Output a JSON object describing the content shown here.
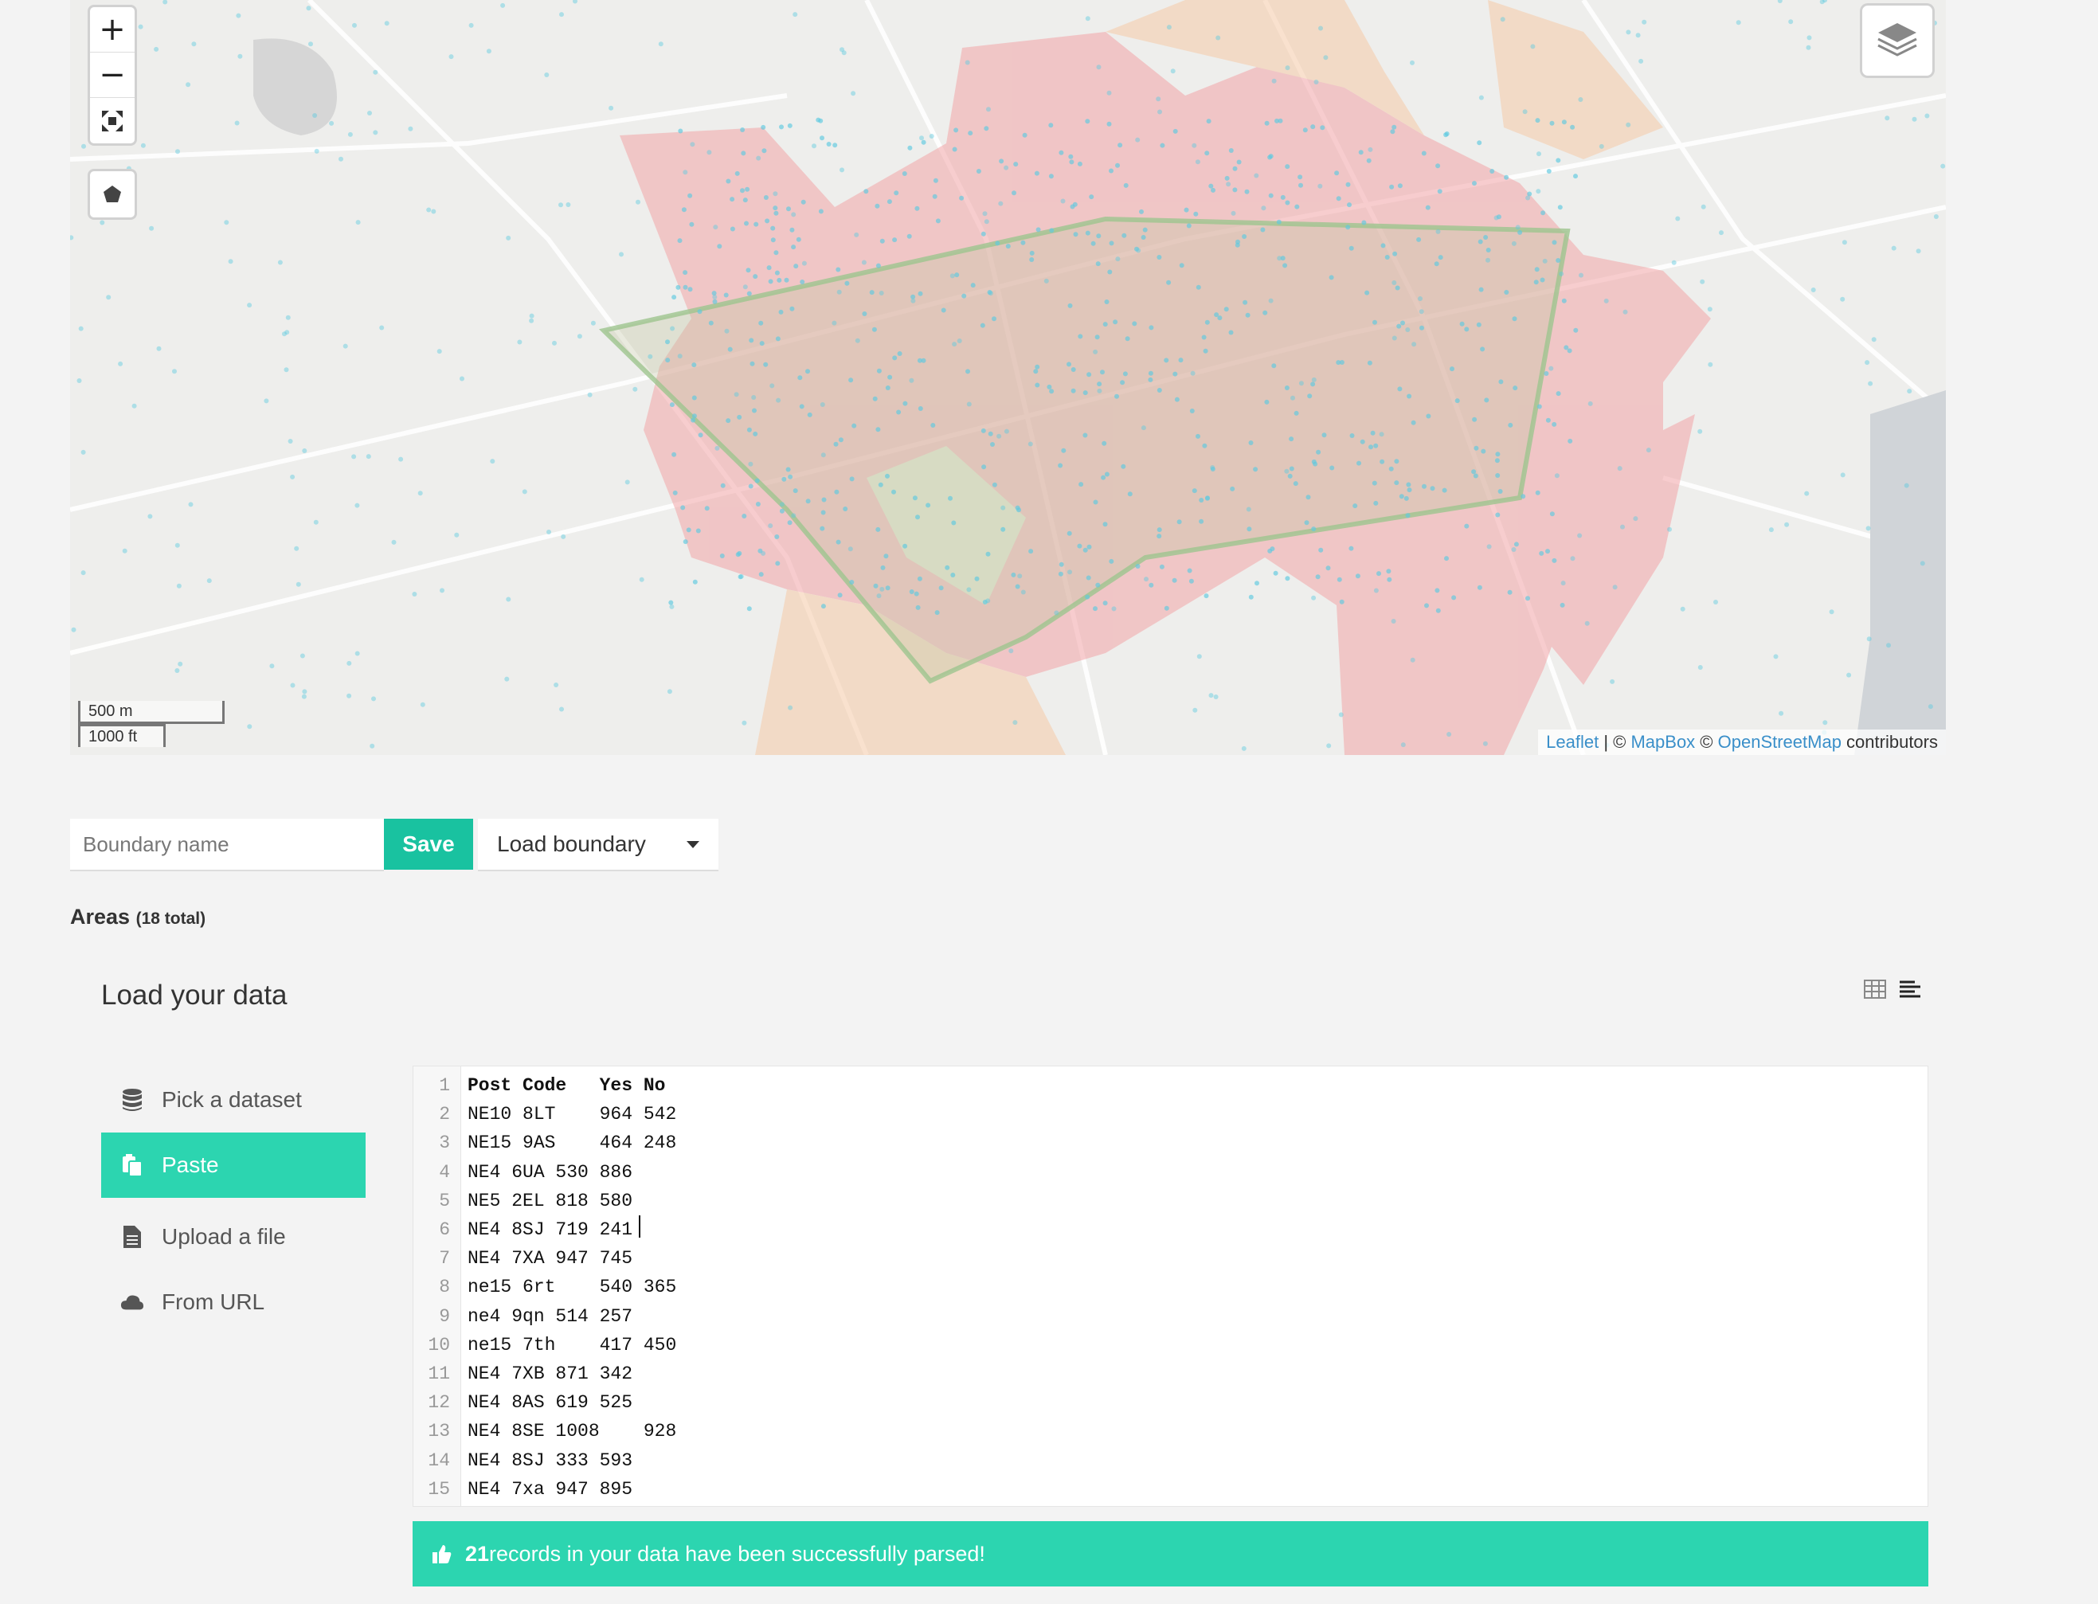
{
  "map": {
    "zoom_in": "+",
    "zoom_out": "−",
    "scale_metric": "500 m",
    "scale_imperial": "1000 ft",
    "attribution": {
      "leaflet": "Leaflet",
      "sep1": " | © ",
      "mapbox": "MapBox",
      "sep2": " © ",
      "osm": "OpenStreetMap",
      "tail": " contributors"
    },
    "colors": {
      "area_red": "#f3a5a8",
      "area_orange": "#f6cba8",
      "boundary_green": "#9ec48f",
      "points": "#5ec9e0"
    }
  },
  "boundary": {
    "name_placeholder": "Boundary name",
    "save_label": "Save",
    "load_label": "Load boundary"
  },
  "areas": {
    "label": "Areas",
    "count": "(18 total)"
  },
  "load_data": {
    "title": "Load your data",
    "nav": [
      {
        "label": "Pick a dataset",
        "icon": "database-icon",
        "active": false
      },
      {
        "label": "Paste",
        "icon": "paste-icon",
        "active": true
      },
      {
        "label": "Upload a file",
        "icon": "file-icon",
        "active": false
      },
      {
        "label": "From URL",
        "icon": "cloud-icon",
        "active": false
      }
    ],
    "editor_lines": [
      {
        "n": "1",
        "text": "Post Code   Yes No "
      },
      {
        "n": "2",
        "text": "NE10 8LT    964 542"
      },
      {
        "n": "3",
        "text": "NE15 9AS    464 248"
      },
      {
        "n": "4",
        "text": "NE4 6UA 530 886"
      },
      {
        "n": "5",
        "text": "NE5 2EL 818 580"
      },
      {
        "n": "6",
        "text": "NE4 8SJ 719 241"
      },
      {
        "n": "7",
        "text": "NE4 7XA 947 745"
      },
      {
        "n": "8",
        "text": "ne15 6rt    540 365"
      },
      {
        "n": "9",
        "text": "ne4 9qn 514 257"
      },
      {
        "n": "10",
        "text": "ne15 7th    417 450"
      },
      {
        "n": "11",
        "text": "NE4 7XB 871 342"
      },
      {
        "n": "12",
        "text": "NE4 8AS 619 525"
      },
      {
        "n": "13",
        "text": "NE4 8SE 1008    928"
      },
      {
        "n": "14",
        "text": "NE4 8SJ 333 593"
      },
      {
        "n": "15",
        "text": "NE4 7xa 947 895"
      }
    ],
    "success_count": "21",
    "success_text": " records in your data have been successfully parsed!",
    "accent": "#2cd5b0"
  }
}
